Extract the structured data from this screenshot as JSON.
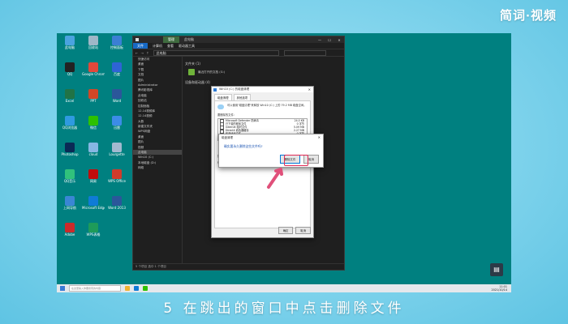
{
  "brand": {
    "left": "简词",
    "dot": "·",
    "right": "视频"
  },
  "caption": "5 在跳出的窗口中点击删除文件",
  "colors": {
    "desktop": "#008080",
    "highlight": "#e02a55",
    "accent": "#0078d7"
  },
  "desktop_icons": [
    {
      "label": "此电脑",
      "color": "#4aa3df"
    },
    {
      "label": "回收站",
      "color": "#9fb7c8"
    },
    {
      "label": "控制面板",
      "color": "#3b7fd4"
    },
    {
      "label": "QQ",
      "color": "#222"
    },
    {
      "label": "Google Chrome",
      "color": "#e2483b"
    },
    {
      "label": "百度",
      "color": "#2f64d6"
    },
    {
      "label": "Excel",
      "color": "#217346"
    },
    {
      "label": "PPT",
      "color": "#d24726"
    },
    {
      "label": "Word",
      "color": "#2b579a"
    },
    {
      "label": "QQ浏览器",
      "color": "#2f9ae0"
    },
    {
      "label": "微信",
      "color": "#2dc100"
    },
    {
      "label": "迅雷",
      "color": "#3c8ce7"
    },
    {
      "label": "Photoshop",
      "color": "#0a2a55"
    },
    {
      "label": "cloud",
      "color": "#86b7e3"
    },
    {
      "label": "Lourgette",
      "color": "#a2b9cf"
    },
    {
      "label": "QQ音乐",
      "color": "#31c27c"
    },
    {
      "label": "网易",
      "color": "#c20c0c"
    },
    {
      "label": "WPS Office",
      "color": "#d03b2b"
    },
    {
      "label": "上网导航",
      "color": "#3a86d4"
    },
    {
      "label": "Microsoft Edge",
      "color": "#0f7bd6"
    },
    {
      "label": "Word 2013",
      "color": "#2b579a"
    },
    {
      "label": "Adobe",
      "color": "#cc2a2a"
    },
    {
      "label": "WPS表格",
      "color": "#1e9b59"
    }
  ],
  "explorer": {
    "manage_tab": "管理",
    "title": "此电脑",
    "ribbon": {
      "file": "文件",
      "tabs": [
        "计算机",
        "查看",
        "驱动器工具"
      ]
    },
    "address": "此电脑",
    "nav": [
      "快速访问",
      "桌面",
      "下载",
      "文档",
      "图片",
      "Administrator",
      "腾讯影视库",
      "此电脑",
      "回收站",
      "控制面板",
      "12.14视频库",
      "12.14视频",
      "大数",
      "新建文件夹",
      "WPS网盘",
      "桌面",
      "图片",
      "视频",
      "此电脑",
      "Win10 (C:)",
      "本地磁盘 (D:)",
      "网络"
    ],
    "group1": "文件夹 (1)",
    "drive1": "最近打开的文档 (G:)",
    "group2": "设备和驱动器 (4)",
    "status": "5 个项目  选中 1 个项目"
  },
  "props": {
    "title": "Win10 (C:) 的磁盘清理",
    "tabs": [
      "磁盘清理",
      "其他选项"
    ],
    "usage": "可以使用\"磁盘清理\"来释放 Win10 (C:) 上的 79.2 MB 磁盘空间。",
    "sec_title": "要删除的文件:",
    "files": [
      {
        "name": "Microsoft Defender 防病毒",
        "size": "24.0 KB"
      },
      {
        "name": "已下载的程序文件",
        "size": "0 字节"
      },
      {
        "name": "Internet 临时文件",
        "size": "5.09 MB"
      },
      {
        "name": "DirectX 着色器缓存",
        "size": "2.27 MB"
      },
      {
        "name": "传递优化文件",
        "size": "0 字节"
      }
    ],
    "desc_title": "描述",
    "desc_text": "Microsoft Defender 防病毒使用的非关键文件",
    "ok": "确定",
    "cancel": "取消"
  },
  "confirm": {
    "title": "磁盘清理",
    "message": "确实要永久删除这些文件吗?",
    "delete_button": "删除文件",
    "cancel_button": "取消"
  },
  "taskbar": {
    "search_placeholder": "在这里输入你要搜索的内容",
    "time": "11:01",
    "date": "2021/10/14"
  },
  "icons": {
    "pointer": "pointer-hand-icon",
    "notify": "document-icon",
    "close": "close-icon"
  }
}
